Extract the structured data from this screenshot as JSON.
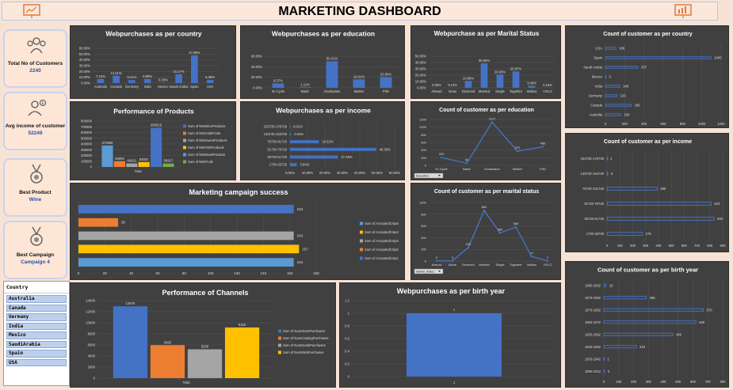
{
  "header": {
    "title": "MARKETING DASHBOARD"
  },
  "kpis": [
    {
      "label": "Total No of Customers",
      "value": "2240",
      "icon": "customers-icon"
    },
    {
      "label": "Avg income of customer",
      "value": "52249",
      "icon": "income-icon"
    },
    {
      "label": "Best Product",
      "value": "Wine",
      "icon": "medal-icon"
    },
    {
      "label": "Best Campaign",
      "value": "Campaign 4",
      "icon": "medal-icon"
    }
  ],
  "slicer": {
    "title": "Country",
    "items": [
      "Australia",
      "Canada",
      "Germany",
      "India",
      "Mexico",
      "SaudiArabia",
      "Spain",
      "USA"
    ]
  },
  "colors": {
    "blue": "#4472c4",
    "orange": "#ed7d31",
    "gray": "#a5a5a5",
    "gold": "#ffc000",
    "lightblue": "#5b9bd5",
    "green": "#70ad47"
  },
  "chart_data": [
    {
      "id": "c1",
      "type": "bar",
      "title": "Webpurchases as per country",
      "categories": [
        "Australia",
        "Canada",
        "Germany",
        "India",
        "Mexico",
        "Saudi Arabia",
        "Spain",
        "USA"
      ],
      "values": [
        7.15,
        12.61,
        5.21,
        6.98,
        0.35,
        15.27,
        47.88,
        5.38
      ],
      "labels": [
        "7.15%",
        "12.61%",
        "5.21%",
        "6.98%",
        "0.35%",
        "15.27%",
        "47.88%",
        "5.38%"
      ],
      "yticks": [
        "0.00%",
        "10.00%",
        "20.00%",
        "30.00%",
        "40.00%",
        "50.00%",
        "60.00%"
      ],
      "ylim": [
        0,
        60
      ]
    },
    {
      "id": "c2",
      "type": "bar",
      "title": "Webpurchases as per education",
      "categories": [
        "2n Cycle",
        "Basic",
        "Graduation",
        "Master",
        "PhD"
      ],
      "values": [
        8.37,
        1.11,
        50.41,
        16.01,
        20.5
      ],
      "labels": [
        "8.37%",
        "1.11%",
        "50.41%",
        "16.01%",
        "20.50%"
      ],
      "yticks": [
        "0.00%",
        "20.00%",
        "40.00%",
        "60.00%"
      ],
      "ylim": [
        0,
        60
      ]
    },
    {
      "id": "c3",
      "type": "bar",
      "title": "Webpurchase as per Marital Status",
      "categories": [
        "Absurd",
        "Alone",
        "Divorced",
        "Married",
        "Single",
        "Together",
        "Widow",
        "YOLO"
      ],
      "values": [
        0.08,
        0.14,
        10.86,
        38.6,
        20.93,
        25.87,
        3.4,
        0.16
      ],
      "labels": [
        "0.08%",
        "0.14%",
        "10.86%",
        "38.60%",
        "20.93%",
        "25.87%",
        "3.40%",
        "0.16%"
      ],
      "yticks": [
        "0.00%",
        "10.00%",
        "20.00%",
        "30.00%",
        "40.00%",
        "50.00%"
      ],
      "ylim": [
        0,
        50
      ]
    },
    {
      "id": "c4",
      "type": "bar-horizontal",
      "title": "Count of customer as per country",
      "categories": [
        "USA",
        "Spain",
        "Saudi Arabia",
        "Mexico",
        "India",
        "Germany",
        "Canada",
        "Australia"
      ],
      "values": [
        109,
        1095,
        337,
        3,
        148,
        120,
        268,
        160
      ],
      "labels": [
        "109",
        "1095",
        "337",
        "3",
        "148",
        "120",
        "268",
        "160"
      ],
      "xticks": [
        "0",
        "200",
        "400",
        "600",
        "800",
        "1000",
        "1200"
      ],
      "xlim": [
        0,
        1200
      ]
    },
    {
      "id": "c5",
      "type": "bar",
      "title": "Performance of Products",
      "categories": [
        "Total"
      ],
      "series": [
        {
          "name": "Sum of MntWineProducts",
          "value": 680816,
          "color": "#4472c4"
        },
        {
          "name": "Sum of MntGoldProds",
          "value": 98609,
          "color": "#ed7d31"
        },
        {
          "name": "Sum of MntSweetProducts",
          "value": 60621,
          "color": "#a5a5a5"
        },
        {
          "name": "Sum of MntFishProducts",
          "value": 84057,
          "color": "#ffc000"
        },
        {
          "name": "Sum of MntMeatProducts",
          "value": 373968,
          "color": "#5b9bd5"
        },
        {
          "name": "Sum of MntFruits",
          "value": 58917,
          "color": "#70ad47"
        }
      ],
      "order": [
        4,
        1,
        2,
        3,
        0,
        5
      ],
      "yticks": [
        "0",
        "100000",
        "200000",
        "300000",
        "400000",
        "500000",
        "600000",
        "700000",
        "800000"
      ],
      "ylim": [
        0,
        800000
      ]
    },
    {
      "id": "c6",
      "type": "bar-horizontal",
      "title": "Webpurchases as per income",
      "categories": [
        "153730-176729",
        "130730-153729",
        "76730-91729",
        "51730-76729",
        "26730-51729",
        "1730-26729"
      ],
      "values": [
        0.01,
        0.54,
        16.52,
        49.35,
        27.48,
        3.84
      ],
      "labels": [
        "0.01%",
        "0.54%",
        "16.52%",
        "49.35%",
        "27.48%",
        "3.84%"
      ],
      "xticks": [
        "0.00%",
        "10.00%",
        "20.00%",
        "30.00%",
        "40.00%",
        "50.00%",
        "60.00%"
      ],
      "xlim": [
        0,
        60
      ]
    },
    {
      "id": "c7",
      "type": "line",
      "title": "Count of customer as per education",
      "categories": [
        "2n Cycle",
        "Basic",
        "Graduation",
        "Master",
        "PhD"
      ],
      "values": [
        203,
        54,
        1127,
        370,
        486
      ],
      "yticks": [
        "0",
        "200",
        "400",
        "600",
        "800",
        "1000",
        "1200"
      ],
      "ylim": [
        0,
        1200
      ],
      "filter": "Education"
    },
    {
      "id": "c8",
      "type": "bar-horizontal",
      "title": "Count of customer as per income",
      "categories": [
        "153730-176729",
        "130730-153729",
        "76730-101729",
        "51730-76729",
        "26730-51729",
        "1730-26729"
      ],
      "values": [
        1,
        6,
        390,
        810,
        833,
        276
      ],
      "labels": [
        "1",
        "6",
        "390",
        "810",
        "833",
        "276"
      ],
      "xticks": [
        "0",
        "100",
        "200",
        "300",
        "400",
        "500",
        "600",
        "700",
        "800",
        "900"
      ],
      "xlim": [
        0,
        900
      ]
    },
    {
      "id": "c9",
      "type": "bar-horizontal",
      "title": "Marketing campaign success",
      "categories": [
        "Sum of AcceptedCmp1",
        "Sum of AcceptedCmp2",
        "Sum of AcceptedCmp3",
        "Sum of AcceptedCmp4",
        "Sum of AcceptedCmp5"
      ],
      "values": [
        163,
        30,
        163,
        167,
        163
      ],
      "labels": [
        "163",
        "30",
        "163",
        "167",
        "163"
      ],
      "colors": [
        "#4472c4",
        "#ed7d31",
        "#a5a5a5",
        "#ffc000",
        "#5b9bd5"
      ],
      "legend": [
        "Sum of AcceptedCmp5",
        "Sum of AcceptedCmp4",
        "Sum of AcceptedCmp3",
        "Sum of AcceptedCmp2",
        "Sum of AcceptedCmp1"
      ],
      "xticks": [
        "0",
        "20",
        "40",
        "60",
        "80",
        "100",
        "120",
        "140",
        "160",
        "180"
      ],
      "xlim": [
        0,
        180
      ]
    },
    {
      "id": "c10",
      "type": "line",
      "title": "Count of customer as per marital status",
      "categories": [
        "Absurd",
        "Alone",
        "Divorced",
        "Married",
        "Single",
        "Together",
        "Widow",
        "YOLO"
      ],
      "values": [
        2,
        3,
        232,
        864,
        480,
        580,
        77,
        2
      ],
      "yticks": [
        "0",
        "200",
        "400",
        "600",
        "800",
        "1000"
      ],
      "ylim": [
        0,
        1000
      ],
      "filter": "Marital_Status"
    },
    {
      "id": "c11",
      "type": "bar-horizontal",
      "title": "Count of customer as  per birth year",
      "categories": [
        "1983-2002",
        "1973-1982",
        "1973-1982",
        "1963-1972",
        "1953-1962",
        "1943-1952",
        "1933-1942",
        "1893-1912"
      ],
      "values": [
        15,
        286,
        670,
        620,
        465,
        219,
        2,
        3
      ],
      "labels": [
        "15",
        "286",
        "670",
        "620",
        "465",
        "219",
        "2",
        "3"
      ],
      "xticks": [
        "0",
        "100",
        "200",
        "300",
        "400",
        "500",
        "600",
        "700",
        "800"
      ],
      "xlim": [
        0,
        800
      ]
    },
    {
      "id": "c12",
      "type": "bar",
      "title": "Performance of Channels",
      "categories": [
        "Total"
      ],
      "series": [
        {
          "name": "Sum of NumStorePurchases",
          "value": 12970,
          "color": "#4472c4"
        },
        {
          "name": "Sum of NumCatalogPurchases",
          "value": 5963,
          "color": "#ed7d31"
        },
        {
          "name": "Sum of NumDealsPurchases",
          "value": 5208,
          "color": "#a5a5a5"
        },
        {
          "name": "Sum of NumWebPurchases",
          "value": 9150,
          "color": "#ffc000"
        }
      ],
      "yticks": [
        "0",
        "2000",
        "4000",
        "6000",
        "8000",
        "10000",
        "12000",
        "14000"
      ],
      "ylim": [
        0,
        14000
      ]
    },
    {
      "id": "c13",
      "type": "bar",
      "title": "Webpurchases as per birth year",
      "categories": [
        "1"
      ],
      "values": [
        1
      ],
      "labels": [
        "1"
      ],
      "yticks": [
        "0",
        "0.2",
        "0.4",
        "0.6",
        "0.8",
        "1",
        "1.2"
      ],
      "ylim": [
        0,
        1.2
      ]
    }
  ]
}
